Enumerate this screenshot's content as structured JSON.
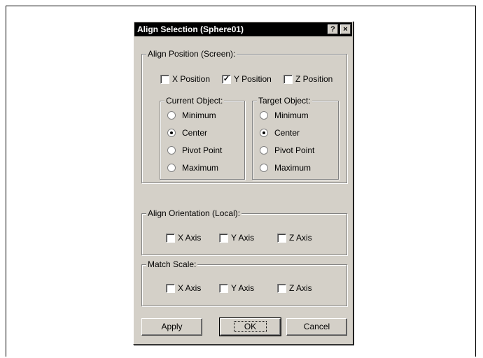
{
  "dialog": {
    "title": "Align Selection (Sphere01)",
    "help_glyph": "?",
    "close_glyph": "×"
  },
  "align_position": {
    "legend": "Align Position (Screen):",
    "x_label": "X Position",
    "x_checked": false,
    "y_label": "Y Position",
    "y_checked": true,
    "z_label": "Z Position",
    "z_checked": false
  },
  "current_object": {
    "legend": "Current Object:",
    "options": [
      "Minimum",
      "Center",
      "Pivot Point",
      "Maximum"
    ],
    "selected": "Center"
  },
  "target_object": {
    "legend": "Target Object:",
    "options": [
      "Minimum",
      "Center",
      "Pivot Point",
      "Maximum"
    ],
    "selected": "Center"
  },
  "align_orientation": {
    "legend": "Align Orientation (Local):",
    "x_label": "X Axis",
    "y_label": "Y Axis",
    "z_label": "Z Axis"
  },
  "match_scale": {
    "legend": "Match Scale:",
    "x_label": "X Axis",
    "y_label": "Y Axis",
    "z_label": "Z Axis"
  },
  "buttons": {
    "apply": "Apply",
    "ok": "OK",
    "cancel": "Cancel"
  },
  "check_glyph": "✓"
}
